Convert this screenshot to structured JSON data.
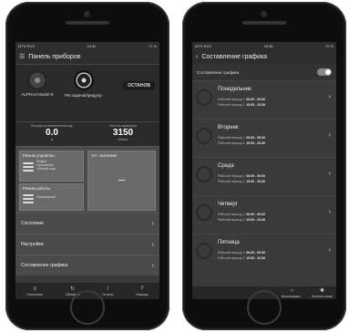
{
  "left_phone": {
    "status": {
      "carrier": "MTS RUS",
      "time": "16:32",
      "battery": "71 %"
    },
    "title": "Панель приборов",
    "device": {
      "name": "ALPHA3 Model B",
      "mode_label": "Рег.задача/предупр.",
      "stop_button": "ОСТАНОВ"
    },
    "readings": [
      {
        "label": "Текущая установленная зад.",
        "value": "0.0",
        "unit": "м"
      },
      {
        "label": "Частота вращения",
        "value": "3150",
        "unit": "об/мин"
      }
    ],
    "tiles": {
      "control_mode": {
        "title": "Режим управлен.",
        "lines": [
          "Режим",
          "постоянное",
          "«Лёгкий ход»"
        ]
      },
      "setpoint": {
        "title": "Уст. значение",
        "value": "–"
      },
      "work_mode": {
        "title": "Режим работы",
        "lines": [
          "Нормальный"
        ]
      }
    },
    "menu": [
      "Состояние",
      "Настройки",
      "Составление графика"
    ],
    "nav": [
      {
        "icon": "≡",
        "label": "Отключить"
      },
      {
        "icon": "↻",
        "label": "Обновить"
      },
      {
        "icon": "/",
        "label": "Отчеты"
      },
      {
        "icon": "?",
        "label": "Помощь"
      }
    ]
  },
  "right_phone": {
    "status": {
      "carrier": "MTS RUS",
      "time": "16:36",
      "battery": "70 %"
    },
    "title": "Составление графика",
    "toggle_label": "Составление графика",
    "period1_label": "Рабочий период 1:",
    "period2_label": "Рабочий период 2:",
    "days": [
      {
        "name": "Понедельник",
        "p1": "06.00 - 09.00",
        "p2": "15.00 - 23.00"
      },
      {
        "name": "Вторник",
        "p1": "06.00 - 09.00",
        "p2": "15.00 - 23.00"
      },
      {
        "name": "Среда",
        "p1": "06.00 - 09.00",
        "p2": "15.00 - 23.00"
      },
      {
        "name": "Четверг",
        "p1": "06.00 - 09.00",
        "p2": "15.00 - 23.00"
      },
      {
        "name": "Пятница",
        "p1": "06.00 - 09.00",
        "p2": "15.00 - 23.00"
      }
    ],
    "bottom": [
      {
        "icon": "○",
        "label": "Использоват..."
      },
      {
        "icon": "✱",
        "label": "Summer mode"
      }
    ]
  }
}
